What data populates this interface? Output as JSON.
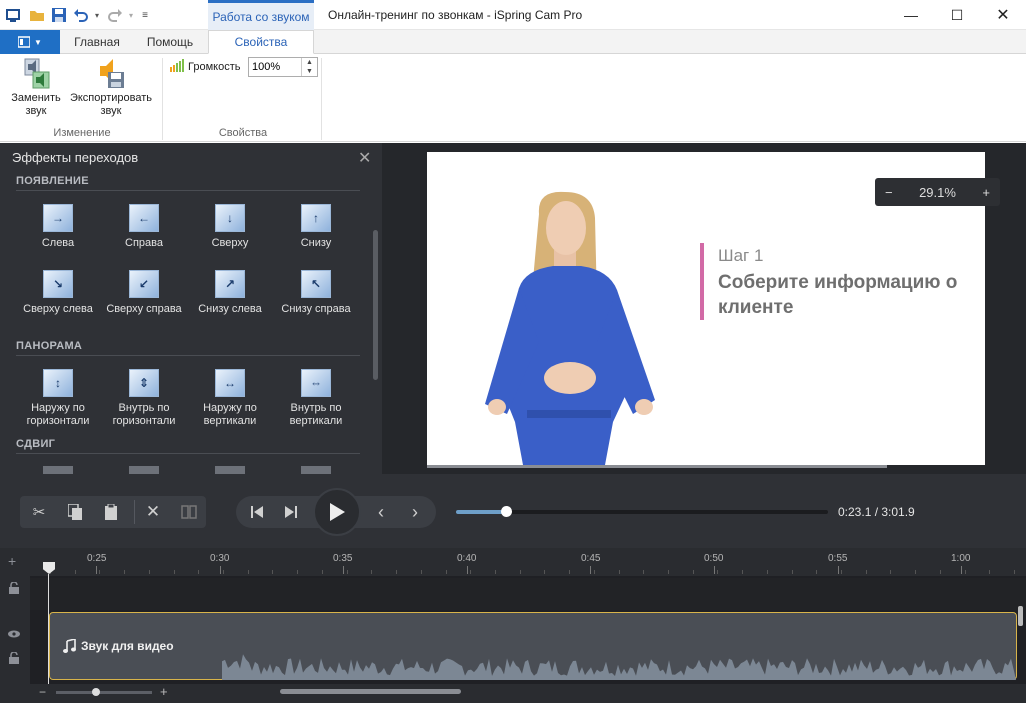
{
  "titlebar": {
    "context_tab": "Работа со звуком",
    "window_title": "Онлайн-тренинг по звонкам - iSpring Cam Pro"
  },
  "ribbon_tabs": [
    {
      "label": "Главная"
    },
    {
      "label": "Помощь"
    },
    {
      "label": "Свойства"
    }
  ],
  "ribbon": {
    "replace_sound": "Заменить звук",
    "export_sound": "Экспортировать звук",
    "group_change": "Изменение",
    "volume_label": "Громкость",
    "volume_value": "100%",
    "group_properties": "Свойства"
  },
  "panel": {
    "title": "Эффекты переходов",
    "sections": [
      {
        "title": "ПОЯВЛЕНИЕ",
        "items": [
          {
            "label": "Слева",
            "icon": "arrow-right"
          },
          {
            "label": "Справа",
            "icon": "arrow-left"
          },
          {
            "label": "Сверху",
            "icon": "arrow-down"
          },
          {
            "label": "Снизу",
            "icon": "arrow-up"
          },
          {
            "label": "Сверху слева",
            "icon": "arrow-down-right"
          },
          {
            "label": "Сверху справа",
            "icon": "arrow-down-left"
          },
          {
            "label": "Снизу слева",
            "icon": "arrow-up-right"
          },
          {
            "label": "Снизу справа",
            "icon": "arrow-up-left"
          }
        ]
      },
      {
        "title": "ПАНОРАМА",
        "items": [
          {
            "label": "Наружу по горизонтали",
            "icon": "expand-vertical"
          },
          {
            "label": "Внутрь по горизонтали",
            "icon": "collapse-vertical"
          },
          {
            "label": "Наружу по вертикали",
            "icon": "expand-horizontal"
          },
          {
            "label": "Внутрь по вертикали",
            "icon": "collapse-horizontal"
          }
        ]
      },
      {
        "title": "СДВИГ",
        "items": []
      }
    ]
  },
  "preview": {
    "zoom": "29.1%",
    "slide_step": "Шаг 1",
    "slide_heading": "Соберите информацию о клиенте"
  },
  "playback": {
    "time": "0:23.1 / 3:01.9",
    "progress": 0.135
  },
  "timeline": {
    "ticks": [
      "0:25",
      "0:30",
      "0:35",
      "0:40",
      "0:45",
      "0:50",
      "0:55",
      "1:00"
    ],
    "clip_label": "Звук для видео"
  },
  "colors": {
    "accent": "#2b6fc4",
    "slide_accent": "#d26aa6",
    "clip_border": "#d8b44a"
  }
}
